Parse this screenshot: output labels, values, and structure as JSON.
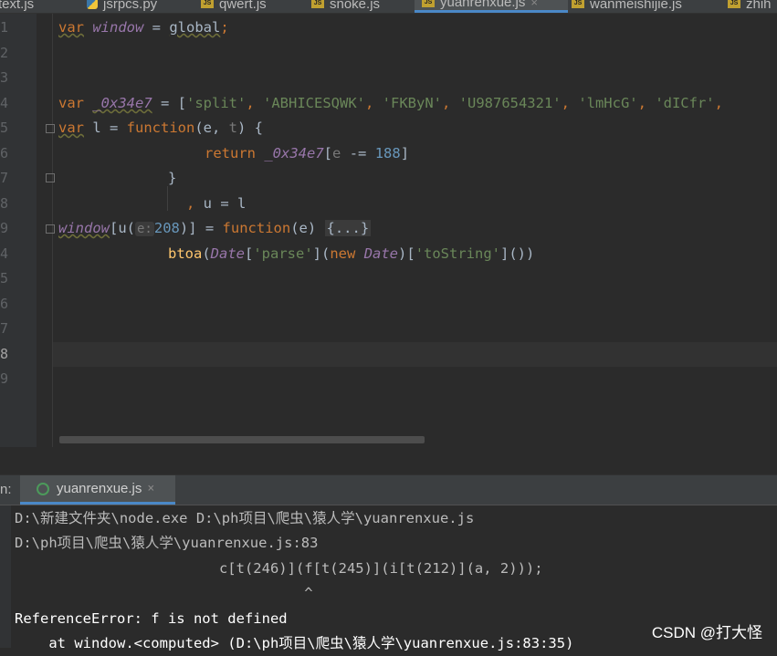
{
  "tabs": [
    {
      "name": "text.js",
      "icon": "js-file-icon",
      "active": false
    },
    {
      "name": "jsrpcs.py",
      "icon": "python-file-icon",
      "active": false
    },
    {
      "name": "qwert.js",
      "icon": "js-file-icon",
      "active": false
    },
    {
      "name": "snoke.js",
      "icon": "js-file-icon",
      "active": false
    },
    {
      "name": "yuanrenxue.js",
      "icon": "js-file-icon",
      "active": true,
      "close": "×"
    },
    {
      "name": "wanmeishijie.js",
      "icon": "js-file-icon",
      "active": false
    },
    {
      "name": "zhih",
      "icon": "js-file-icon",
      "active": false
    }
  ],
  "editor": {
    "line_numbers": [
      "1",
      "2",
      "3",
      "4",
      "5",
      "6",
      "7",
      "8",
      "9",
      "4",
      "5",
      "6",
      "7",
      "8",
      "9"
    ],
    "lines": {
      "l1": {
        "kw": "var",
        "name": "window",
        "rest": " = ",
        "val": "global",
        "end": ";"
      },
      "l4": {
        "kw": "var",
        "name": "_0x34e7",
        "rest": " = [",
        "s1": "'split'",
        "s2": "'ABHICESQWK'",
        "s3": "'FKByN'",
        "s4": "'U987654321'",
        "s5": "'lmHcG'",
        "s6": "'dICfr'",
        "tail": ","
      },
      "l5": {
        "kw": "var",
        "rest1": " l = ",
        "kw2": "function",
        "rest2": "(e, ",
        "param": "t",
        "rest3": ") {"
      },
      "l6": {
        "kw": "return",
        "name": "_0x34e7",
        "rest1": "[",
        "param": "e",
        "rest2": " -= ",
        "num": "188",
        "rest3": "]"
      },
      "l7": {
        "text": "}"
      },
      "l8": {
        "kw": ", ",
        "text": "u = l"
      },
      "l9": {
        "name": "window",
        "rest1": "[u(",
        "hint": "e:",
        "num": "208",
        "rest2": ")] = ",
        "kw": "function",
        "rest3": "(e) ",
        "fold": "{...}"
      },
      "l10": {
        "fn": "btoa",
        "rest1": "(",
        "cls": "Date",
        "rest2": "[",
        "s1": "'parse'",
        "rest3": "](",
        "kw": "new",
        "cls2": "Date",
        "rest4": ")[",
        "s2": "'toString'",
        "rest5": "]())"
      }
    }
  },
  "run": {
    "label": "n:",
    "tab_label": "yuanrenxue.js",
    "close": "×",
    "console_lines": [
      "D:\\新建文件夹\\node.exe D:\\ph项目\\爬虫\\猿人学\\yuanrenxue.js",
      "D:\\ph项目\\爬虫\\猿人学\\yuanrenxue.js:83",
      "                        c[t(246)](f[t(245)](i[t(212)](a, 2)));",
      "                                  ^",
      "",
      "ReferenceError: f is not defined",
      "    at window.<computed> (D:\\ph项目\\爬虫\\猿人学\\yuanrenxue.js:83:35)"
    ]
  },
  "watermark": "CSDN @打大怪",
  "colors": {
    "keyword": "#cc7832",
    "global": "#9876aa",
    "string": "#6a8759",
    "number": "#6897bb",
    "function": "#ffc66d",
    "text": "#a9b7c6",
    "accent": "#4a88c7"
  }
}
